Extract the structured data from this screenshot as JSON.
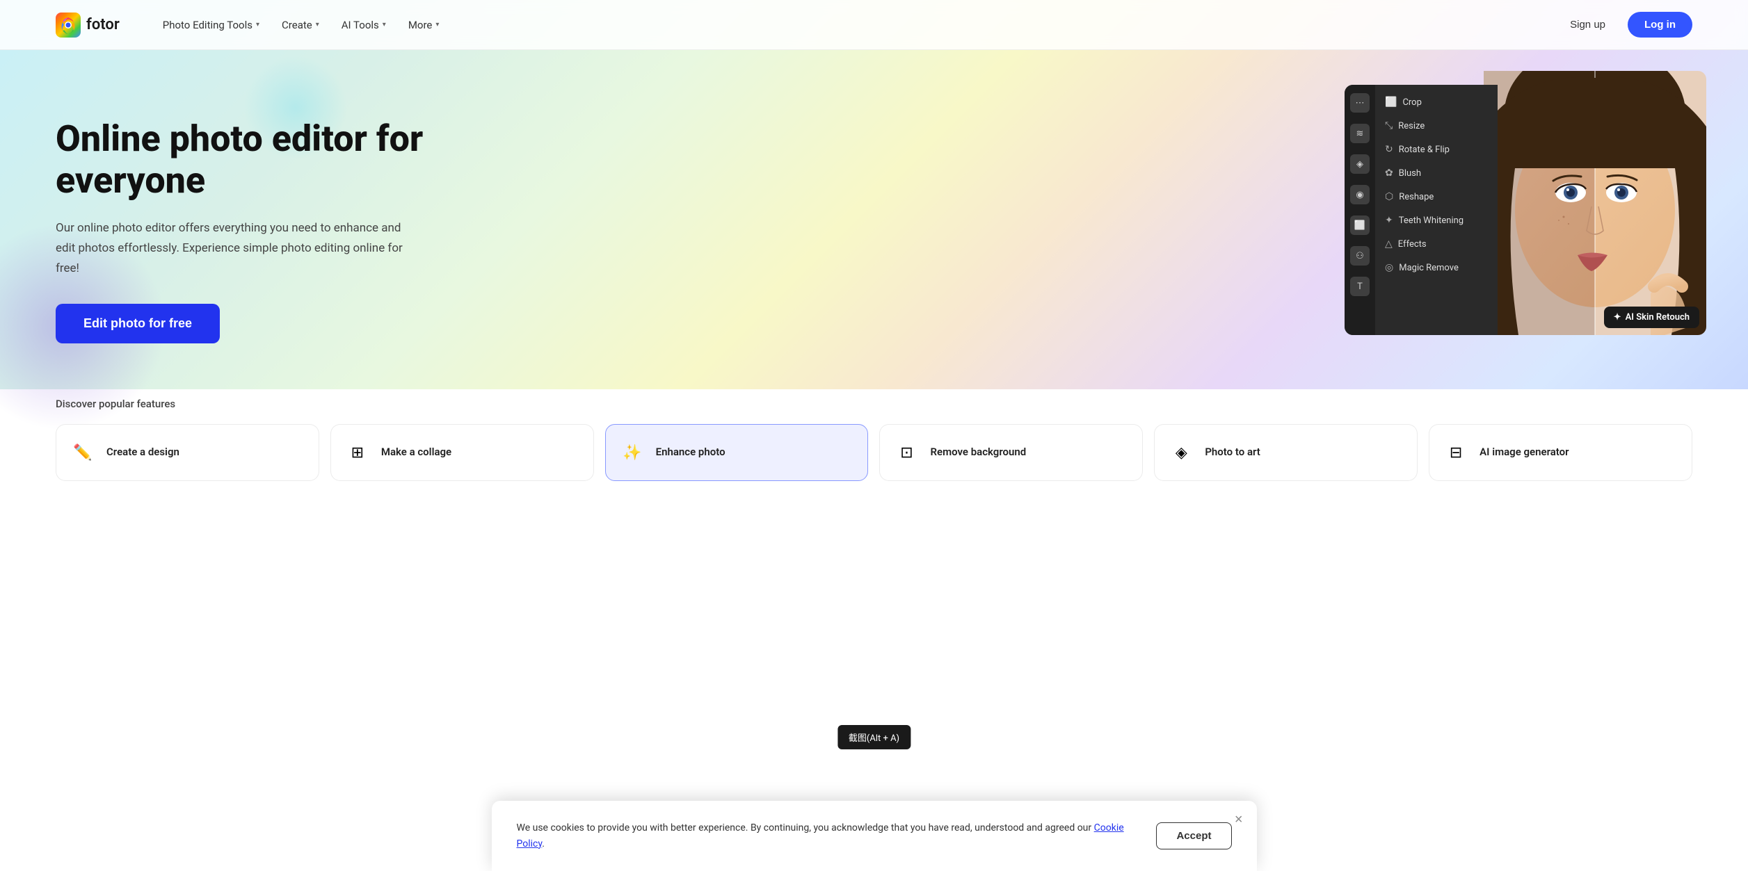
{
  "brand": {
    "name": "fotor",
    "logo_emoji": "🎨"
  },
  "nav": {
    "items": [
      {
        "label": "Photo Editing Tools",
        "has_chevron": true
      },
      {
        "label": "Create",
        "has_chevron": true
      },
      {
        "label": "AI Tools",
        "has_chevron": true
      },
      {
        "label": "More",
        "has_chevron": true
      }
    ],
    "signup_label": "Sign up",
    "login_label": "Log in"
  },
  "hero": {
    "title": "Online photo editor for everyone",
    "description": "Our online photo editor offers everything you need to enhance and edit photos effortlessly. Experience simple photo editing online for free!",
    "cta_label": "Edit photo for free",
    "editor_panel": {
      "menu_items": [
        {
          "icon": "⬜",
          "label": "Crop"
        },
        {
          "icon": "⤡",
          "label": "Resize"
        },
        {
          "icon": "↻",
          "label": "Rotate & Flip"
        },
        {
          "icon": "✿",
          "label": "Blush"
        },
        {
          "icon": "⬡",
          "label": "Reshape"
        },
        {
          "icon": "✦",
          "label": "Teeth Whitening"
        },
        {
          "icon": "△",
          "label": "Effects"
        },
        {
          "icon": "◎",
          "label": "Magic Remove"
        }
      ]
    },
    "ai_badge_label": "AI Skin Retouch"
  },
  "features": {
    "discover_label": "Discover popular features",
    "cards": [
      {
        "icon": "✏",
        "name": "Create a design"
      },
      {
        "icon": "⊞",
        "name": "Make a collage"
      },
      {
        "icon": "✨",
        "name": "Enhance photo"
      },
      {
        "icon": "⊡",
        "name": "Remove background"
      },
      {
        "icon": "◈",
        "name": "Photo to art"
      },
      {
        "icon": "⊟",
        "name": "AI image generator"
      }
    ]
  },
  "cookie_banner": {
    "text": "We use cookies to provide you with better experience. By continuing, you acknowledge that you have read, understood and agreed our",
    "link_text": "Cookie Policy",
    "period": ".",
    "accept_label": "Accept",
    "close_symbol": "×"
  },
  "screenshot_tooltip": {
    "label": "截图(Alt + A)"
  }
}
